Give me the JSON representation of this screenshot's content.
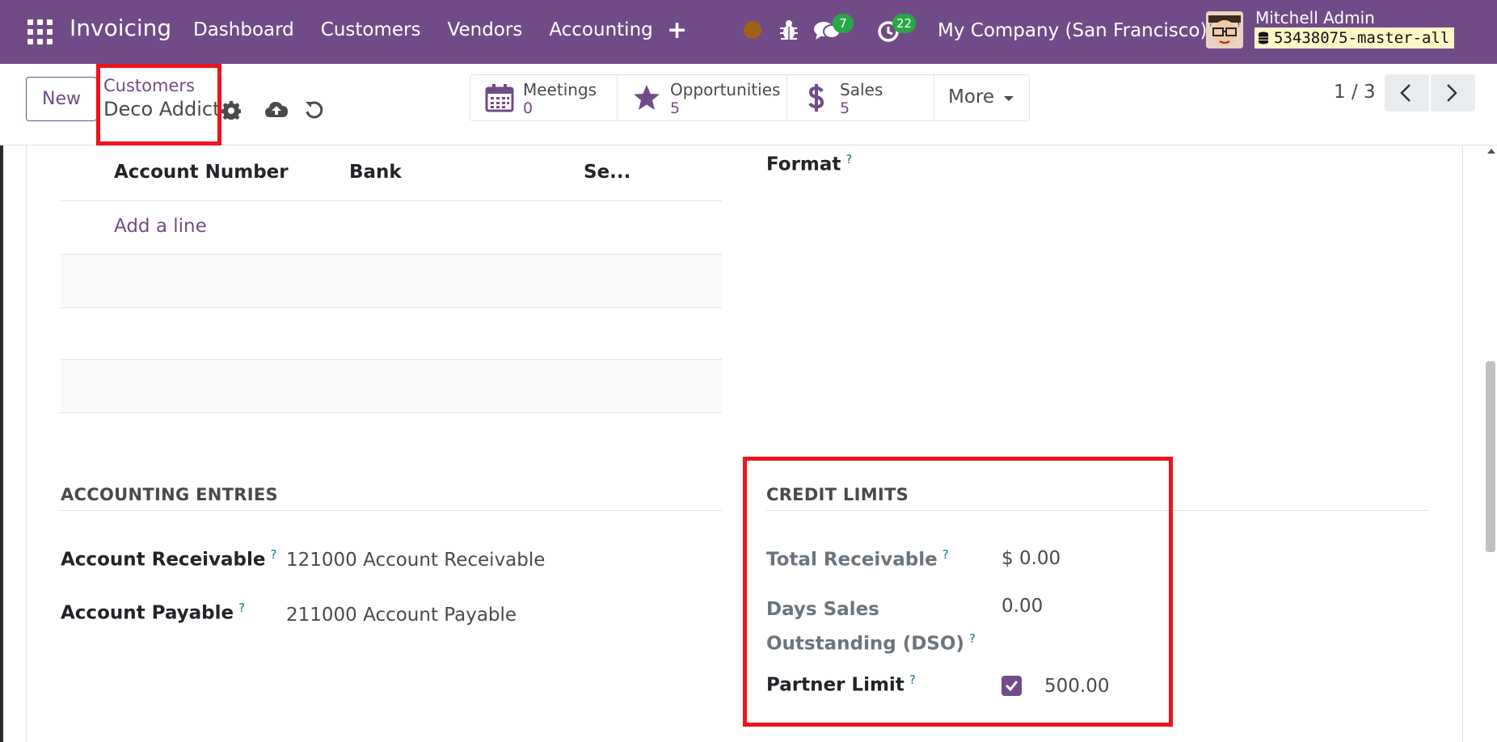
{
  "navbar": {
    "app_name": "Invoicing",
    "menu": [
      "Dashboard",
      "Customers",
      "Vendors",
      "Accounting"
    ],
    "plus_label": "+",
    "chat_count": "7",
    "activity_count": "22",
    "company": "My Company (San Francisco)",
    "user_name": "Mitchell Admin",
    "db_name": "53438075-master-all"
  },
  "control": {
    "new_label": "New",
    "breadcrumb_parent": "Customers",
    "breadcrumb_current": "Deco Addict",
    "smart_buttons": [
      {
        "label": "Meetings",
        "value": "0"
      },
      {
        "label": "Opportunities",
        "value": "5"
      },
      {
        "label": "Sales",
        "value": "5"
      }
    ],
    "more_label": "More",
    "pager": "1 / 3"
  },
  "bank_table": {
    "columns": [
      "Account Number",
      "Bank",
      "Se..."
    ],
    "add_line": "Add a line"
  },
  "format": {
    "label": "Format",
    "help": "?"
  },
  "accounting_entries": {
    "title": "ACCOUNTING ENTRIES",
    "fields": [
      {
        "label": "Account Receivable",
        "help": "?",
        "value": "121000 Account Receivable"
      },
      {
        "label": "Account Payable",
        "help": "?",
        "value": "211000 Account Payable"
      }
    ]
  },
  "credit_limits": {
    "title": "CREDIT LIMITS",
    "total_receivable_label": "Total Receivable",
    "total_receivable_value": "$ 0.00",
    "dso_label_line1": "Days Sales",
    "dso_label_line2": "Outstanding (DSO)",
    "dso_value": "0.00",
    "partner_limit_label": "Partner Limit",
    "partner_limit_checked": true,
    "partner_limit_value": "500.00",
    "help": "?"
  },
  "colors": {
    "brand": "#714b87",
    "highlight": "#f0131e",
    "badge": "#28a745",
    "help": "#017e84"
  }
}
